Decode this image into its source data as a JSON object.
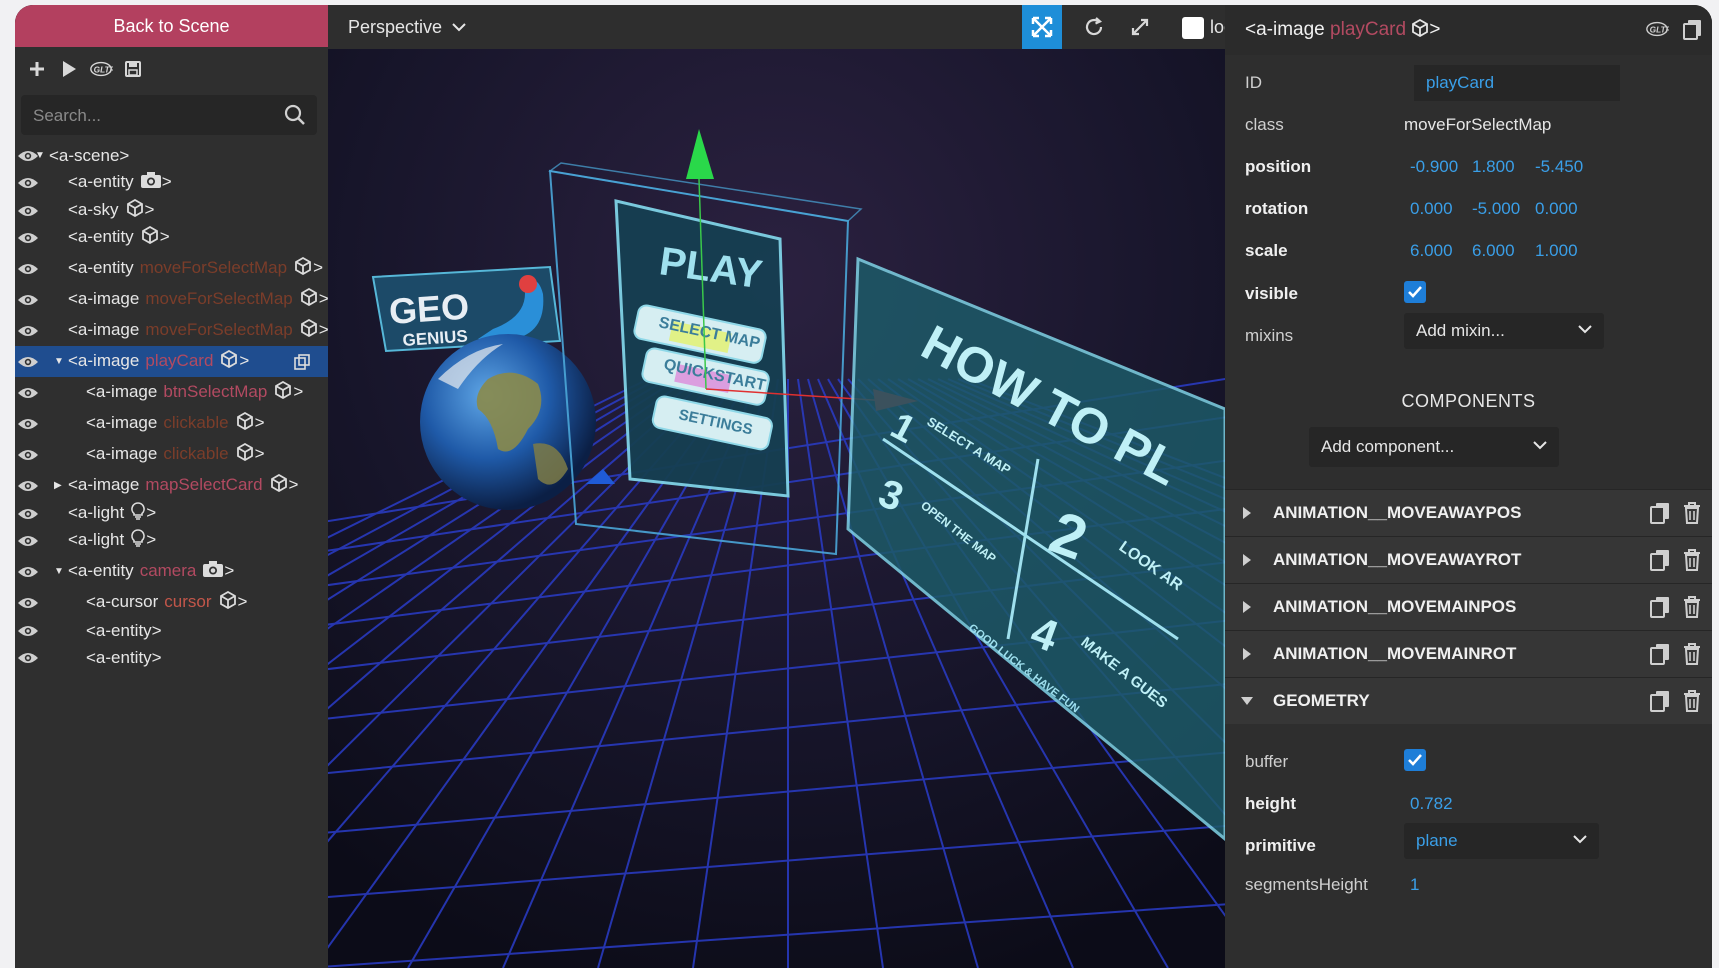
{
  "sidebar": {
    "back_label": "Back to Scene",
    "search_placeholder": "Search...",
    "tree": [
      {
        "tag": "<a-scene>",
        "attr": "",
        "attr_color": "",
        "icon": "",
        "caret": "down",
        "level": 0
      },
      {
        "tag": "<a-entity",
        "attr": "",
        "attr_color": "",
        "icon": "camera-icon",
        "caret": "",
        "level": 1
      },
      {
        "tag": "<a-sky",
        "attr": "",
        "attr_color": "",
        "icon": "cube-icon",
        "caret": "",
        "level": 1
      },
      {
        "tag": "<a-entity",
        "attr": "",
        "attr_color": "",
        "icon": "cube-icon",
        "caret": "",
        "level": 1
      },
      {
        "tag": "<a-entity",
        "attr": "moveForSelectMap",
        "attr_color": "brown",
        "icon": "cube-icon",
        "caret": "",
        "level": 1
      },
      {
        "tag": "<a-image",
        "attr": "moveForSelectMap",
        "attr_color": "brown",
        "icon": "cube-icon",
        "caret": "",
        "level": 1
      },
      {
        "tag": "<a-image",
        "attr": "moveForSelectMap",
        "attr_color": "brown",
        "icon": "cube-icon",
        "caret": "",
        "level": 1
      },
      {
        "tag": "<a-image",
        "attr": "playCard",
        "attr_color": "pink",
        "icon": "cube-icon",
        "caret": "down",
        "level": 1,
        "selected": true
      },
      {
        "tag": "<a-image",
        "attr": "btnSelectMap",
        "attr_color": "pink",
        "icon": "cube-icon",
        "caret": "",
        "level": 2
      },
      {
        "tag": "<a-image",
        "attr": "clickable",
        "attr_color": "brown",
        "icon": "cube-icon",
        "caret": "",
        "level": 2
      },
      {
        "tag": "<a-image",
        "attr": "clickable",
        "attr_color": "brown",
        "icon": "cube-icon",
        "caret": "",
        "level": 2
      },
      {
        "tag": "<a-image",
        "attr": "mapSelectCard",
        "attr_color": "pink",
        "icon": "cube-icon",
        "caret": "right",
        "level": 1
      },
      {
        "tag": "<a-light",
        "attr": "",
        "attr_color": "",
        "icon": "bulb-icon",
        "caret": "",
        "level": 1
      },
      {
        "tag": "<a-light",
        "attr": "",
        "attr_color": "",
        "icon": "bulb-icon",
        "caret": "",
        "level": 1
      },
      {
        "tag": "<a-entity",
        "attr": "camera",
        "attr_color": "pink",
        "icon": "camera-icon",
        "caret": "down",
        "level": 1
      },
      {
        "tag": "<a-cursor",
        "attr": "cursor",
        "attr_color": "red",
        "icon": "cube-icon",
        "caret": "",
        "level": 2
      },
      {
        "tag": "<a-entity>",
        "attr": "",
        "attr_color": "",
        "icon": "",
        "caret": "",
        "level": 2
      },
      {
        "tag": "<a-entity>",
        "attr": "",
        "attr_color": "",
        "icon": "",
        "caret": "",
        "level": 2
      }
    ]
  },
  "viewport": {
    "camera_label": "Perspective",
    "local_label": "local",
    "scene": {
      "geo_line1": "GEO",
      "geo_line2": "GENIUS",
      "play_title": "PLAY",
      "btn_select": "SELECT MAP",
      "btn_quick": "QUICKSTART",
      "btn_settings": "SETTINGS",
      "howto_title": "HOW TO PL",
      "step1": "1",
      "step2": "2",
      "step3": "3",
      "step4": "4",
      "step1_text": "SELECT A MAP",
      "step2_text": "LOOK AR",
      "step3_text": "OPEN THE MAP",
      "step4_text": "MAKE A GUES",
      "footer_text": "GOOD LUCK & HAVE FUN"
    }
  },
  "panel": {
    "title_tag": "<a-image",
    "title_id": "playCard",
    "title_end": ">",
    "props": {
      "id_label": "ID",
      "id_value": "playCard",
      "class_label": "class",
      "class_value": "moveForSelectMap",
      "position_label": "position",
      "position": [
        "-0.900",
        "1.800",
        "-5.450"
      ],
      "rotation_label": "rotation",
      "rotation": [
        "0.000",
        "-5.000",
        "0.000"
      ],
      "scale_label": "scale",
      "scale": [
        "6.000",
        "6.000",
        "1.000"
      ],
      "visible_label": "visible",
      "visible": true,
      "mixins_label": "mixins",
      "mixins_value": "Add mixin..."
    },
    "components_heading": "COMPONENTS",
    "add_component": "Add component...",
    "components": [
      {
        "name": "ANIMATION__MOVEAWAYPOS",
        "expanded": false
      },
      {
        "name": "ANIMATION__MOVEAWAYROT",
        "expanded": false
      },
      {
        "name": "ANIMATION__MOVEMAINPOS",
        "expanded": false
      },
      {
        "name": "ANIMATION__MOVEMAINROT",
        "expanded": false
      },
      {
        "name": "GEOMETRY",
        "expanded": true
      }
    ],
    "geometry": {
      "buffer_label": "buffer",
      "buffer": true,
      "height_label": "height",
      "height_value": "0.782",
      "primitive_label": "primitive",
      "primitive_value": "plane",
      "segments_label": "segmentsHeight",
      "segments_value": "1"
    }
  },
  "colors": {
    "accent": "#1e8ed8",
    "back_button": "#b3405f",
    "selected_row": "#1f4d8f",
    "value_blue": "#3a9fe8",
    "id_pink": "#b24a61"
  }
}
